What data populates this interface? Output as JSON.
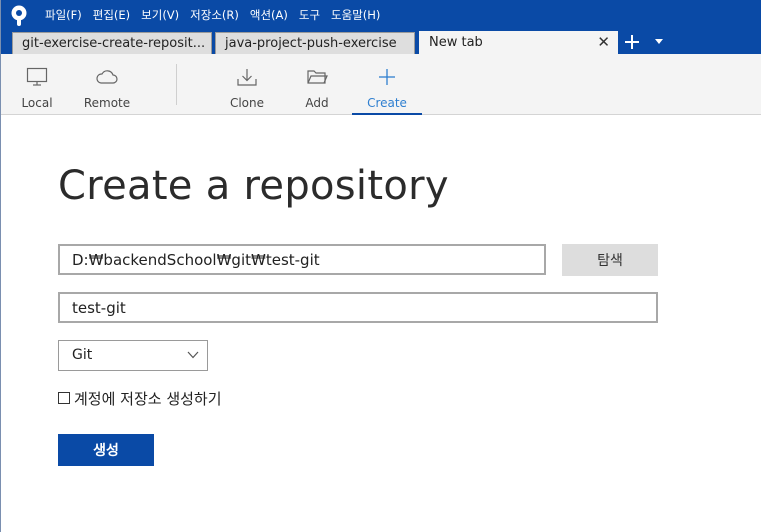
{
  "menu": {
    "items": [
      "파일(F)",
      "편집(E)",
      "보기(V)",
      "저장소(R)",
      "액션(A)",
      "도구",
      "도움말(H)"
    ]
  },
  "tabs": [
    {
      "label": "git-exercise-create-reposit..."
    },
    {
      "label": "java-project-push-exercise"
    },
    {
      "label": "New tab"
    }
  ],
  "icons": {
    "tab_close": "close-icon",
    "tab_add": "plus-icon",
    "tab_menu": "chevron-down-icon"
  },
  "toolbar": {
    "local": {
      "label": "Local",
      "icon": "monitor-icon"
    },
    "remote": {
      "label": "Remote",
      "icon": "cloud-icon"
    },
    "clone": {
      "label": "Clone",
      "icon": "download-icon"
    },
    "add": {
      "label": "Add",
      "icon": "folder-icon"
    },
    "create": {
      "label": "Create",
      "icon": "plus-icon"
    }
  },
  "form": {
    "title": "Create a repository",
    "path_value": "D:₩backendSchool₩git₩test-git",
    "browse_label": "탐색",
    "name_value": "test-git",
    "vcs_selected": "Git",
    "account_checkbox_label": "계정에 저장소 생성하기",
    "account_checkbox_checked": false,
    "create_label": "생성"
  },
  "colors": {
    "brand": "#0a4aa6",
    "active_tool": "#2f7fd0",
    "toolbar_bg": "#f4f4f4"
  }
}
